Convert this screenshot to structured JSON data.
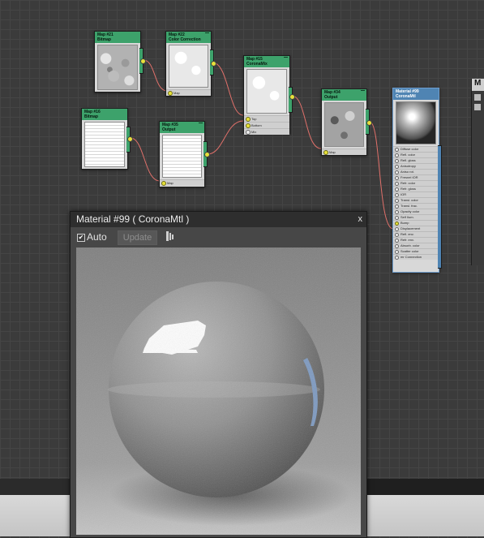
{
  "nodes": {
    "map21": {
      "id": "Map #21",
      "type": "Bitmap"
    },
    "map22": {
      "id": "Map #22",
      "type": "Color Correction",
      "slot": "Map"
    },
    "map15": {
      "id": "Map #15",
      "type": "CoronaMix",
      "slots": [
        "Top",
        "Bottom",
        "Mix"
      ]
    },
    "map34": {
      "id": "Map #34",
      "type": "Output",
      "slot": "Map"
    },
    "map16": {
      "id": "Map #16",
      "type": "Bitmap"
    },
    "map35": {
      "id": "Map #35",
      "type": "Output",
      "slot": "Map"
    },
    "mat99": {
      "id": "Material #99",
      "type": "CoronaMtl",
      "slots": [
        "Diffuse color",
        "Refl. color",
        "Refl. gloss",
        "Anisotropy",
        "Aniso rot.",
        "Fresnel IOR",
        "Refr. color",
        "Refr. gloss",
        "IOR",
        "Transl. color",
        "Transl. frac.",
        "Opacity color",
        "Self Ilum.",
        "Bump",
        "Displacement",
        "Refl. env.",
        "Refr. env.",
        "Absorb. color",
        "Scatter color",
        "mr Connection"
      ]
    }
  },
  "side_panel": {
    "header": "M"
  },
  "preview": {
    "title": "Material #99  ( CoronaMtl )",
    "close": "x",
    "auto_label": "Auto",
    "auto_checked": true,
    "update_label": "Update"
  },
  "colors": {
    "node_header": "#3da26b",
    "material_header": "#4f84b3",
    "socket": "#e7e13a",
    "wire": "#e0706a"
  }
}
